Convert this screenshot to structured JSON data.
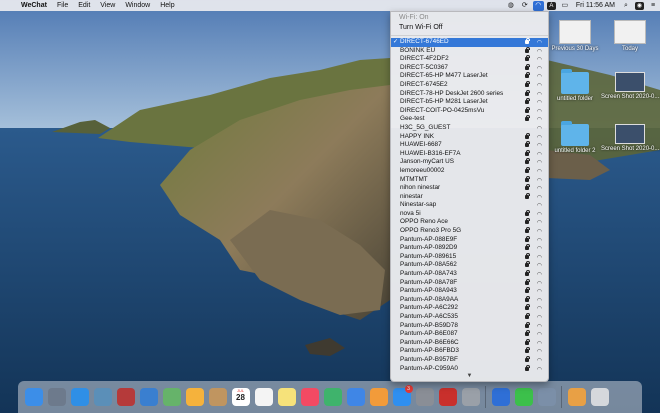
{
  "menubar": {
    "app_name": "WeChat",
    "menus": [
      "File",
      "Edit",
      "View",
      "Window",
      "Help"
    ],
    "clock": "Fri 11:56 AM"
  },
  "desktop": {
    "icons": [
      {
        "label": "Previous 30 Days"
      },
      {
        "label": "Today"
      },
      {
        "label": "untitled folder"
      },
      {
        "label": "Screen Shot 2020-0....2 AM"
      },
      {
        "label": "untitled folder 2"
      },
      {
        "label": "Screen Shot 2020-0....39.16 PM"
      }
    ]
  },
  "wifi_menu": {
    "status": "Wi-Fi: On",
    "toggle_label": "Turn Wi-Fi Off",
    "networks": [
      {
        "name": "DIRECT-6746ED",
        "selected": true,
        "locked": true
      },
      {
        "name": "BONINK EU",
        "locked": true
      },
      {
        "name": "DIRECT-4F2DF2",
        "locked": true
      },
      {
        "name": "DIRECT-5C0367",
        "locked": true
      },
      {
        "name": "DIRECT-65-HP M477 LaserJet",
        "locked": true
      },
      {
        "name": "DIRECT-6745E2",
        "locked": true
      },
      {
        "name": "DIRECT-78-HP DeskJet 2600 series",
        "locked": true
      },
      {
        "name": "DIRECT-b5-HP M281 LaserJet",
        "locked": true
      },
      {
        "name": "DIRECT-COIT-PO-0425msVu",
        "locked": true
      },
      {
        "name": "Gee-test",
        "locked": true
      },
      {
        "name": "H3C_5G_GUEST",
        "locked": false
      },
      {
        "name": "HAPPY INK",
        "locked": true
      },
      {
        "name": "HUAWEI-6687",
        "locked": true
      },
      {
        "name": "HUAWEI-B316-EF7A",
        "locked": true
      },
      {
        "name": "Janson-myCart US",
        "locked": true
      },
      {
        "name": "lemoreeu00002",
        "locked": true
      },
      {
        "name": "MTMTMT",
        "locked": true
      },
      {
        "name": "nihon ninestar",
        "locked": true
      },
      {
        "name": "ninestar",
        "locked": true
      },
      {
        "name": "Ninestar-sap",
        "locked": false
      },
      {
        "name": "nova 5i",
        "locked": true
      },
      {
        "name": "OPPO Reno Ace",
        "locked": true
      },
      {
        "name": "OPPO Reno3 Pro 5G",
        "locked": true
      },
      {
        "name": "Pantum-AP-088E9F",
        "locked": true
      },
      {
        "name": "Pantum-AP-0892D9",
        "locked": true
      },
      {
        "name": "Pantum-AP-089615",
        "locked": true
      },
      {
        "name": "Pantum-AP-08A562",
        "locked": true
      },
      {
        "name": "Pantum-AP-08A743",
        "locked": true
      },
      {
        "name": "Pantum-AP-08A78F",
        "locked": true
      },
      {
        "name": "Pantum-AP-08A943",
        "locked": true
      },
      {
        "name": "Pantum-AP-08A9AA",
        "locked": true
      },
      {
        "name": "Pantum-AP-A6C292",
        "locked": true
      },
      {
        "name": "Pantum-AP-A6C535",
        "locked": true
      },
      {
        "name": "Pantum-AP-B59D78",
        "locked": true
      },
      {
        "name": "Pantum-AP-B6E087",
        "locked": true
      },
      {
        "name": "Pantum-AP-B6E66C",
        "locked": true
      },
      {
        "name": "Pantum-AP-B6FBD3",
        "locked": true
      },
      {
        "name": "Pantum-AP-B957BF",
        "locked": true
      },
      {
        "name": "Pantum-AP-C959A0",
        "locked": true
      }
    ]
  },
  "dock": {
    "calendar": {
      "month": "JUL",
      "day": "28"
    },
    "badges": {
      "mail": "3"
    },
    "apps": [
      {
        "icon": "finder-icon",
        "color": "#3c8ee8"
      },
      {
        "icon": "launchpad-icon",
        "color": "#6d7a8c"
      },
      {
        "icon": "safari-icon",
        "color": "#2f8fe6"
      },
      {
        "icon": "photo-viewer-icon",
        "color": "#5b8fb8"
      },
      {
        "icon": "photo-booth-icon",
        "color": "#b53a3a"
      },
      {
        "icon": "finder-blue-icon",
        "color": "#3a7fd0"
      },
      {
        "icon": "maps-icon",
        "color": "#66b36a"
      },
      {
        "icon": "photos-icon",
        "color": "#f5b23c"
      },
      {
        "icon": "contacts-icon",
        "color": "#c09560"
      },
      {
        "icon": "calendar-icon",
        "color": "#ffffff"
      },
      {
        "icon": "reminders-icon",
        "color": "#f4f4f4"
      },
      {
        "icon": "notes-icon",
        "color": "#f6e27a"
      },
      {
        "icon": "music-icon",
        "color": "#f34a63"
      },
      {
        "icon": "numbers-icon",
        "color": "#3fb36c"
      },
      {
        "icon": "keynote-icon",
        "color": "#3f86e6"
      },
      {
        "icon": "pages-icon",
        "color": "#f29b3a"
      },
      {
        "icon": "app-store-icon",
        "color": "#2e8ff0"
      },
      {
        "icon": "system-preferences-icon",
        "color": "#8a8e96"
      },
      {
        "icon": "acrobat-icon",
        "color": "#c9302c"
      },
      {
        "icon": "printer-icon",
        "color": "#9aa0a8"
      }
    ],
    "apps_right": [
      {
        "icon": "wps-icon",
        "color": "#2f6fd6"
      },
      {
        "icon": "wechat-icon",
        "color": "#3cc04b"
      },
      {
        "icon": "preview-icon",
        "color": "#7b8fa8"
      }
    ],
    "apps_end": [
      {
        "icon": "downloads-icon",
        "color": "#e8a045"
      },
      {
        "icon": "trash-icon",
        "color": "#d5d8dc"
      }
    ]
  }
}
